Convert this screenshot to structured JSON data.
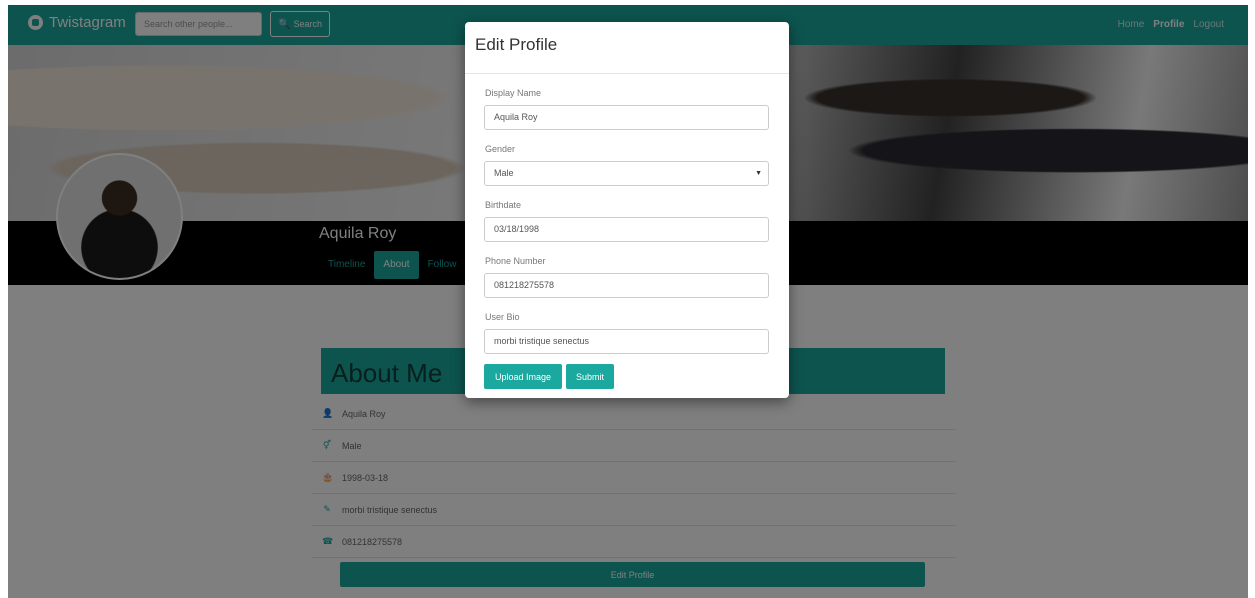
{
  "navbar": {
    "brand": "Twistagram",
    "search_placeholder": "Search other people...",
    "search_button": "Search",
    "links": [
      {
        "label": "Home",
        "active": false
      },
      {
        "label": "Profile",
        "active": true
      },
      {
        "label": "Logout",
        "active": false
      }
    ]
  },
  "profile": {
    "name": "Aquila Roy",
    "tabs": [
      {
        "label": "Timeline",
        "active": false
      },
      {
        "label": "About",
        "active": true
      },
      {
        "label": "Follow",
        "active": false
      }
    ]
  },
  "about": {
    "title": "About Me",
    "rows": [
      {
        "icon": "user-icon",
        "value": "Aquila Roy"
      },
      {
        "icon": "gender-icon",
        "value": "Male"
      },
      {
        "icon": "birthday-cake-icon",
        "value": "1998-03-18"
      },
      {
        "icon": "pencil-icon",
        "value": "morbi tristique senectus"
      },
      {
        "icon": "phone-icon",
        "value": "081218275578"
      }
    ],
    "edit_button": "Edit Profile"
  },
  "modal": {
    "title": "Edit Profile",
    "display_name_label": "Display Name",
    "display_name_value": "Aquila Roy",
    "gender_label": "Gender",
    "gender_value": "Male",
    "birthdate_label": "Birthdate",
    "birthdate_value": "03/18/1998",
    "phone_label": "Phone Number",
    "phone_value": "081218275578",
    "bio_label": "User Bio",
    "bio_value": "morbi tristique senectus",
    "upload_button": "Upload Image",
    "submit_button": "Submit"
  },
  "colors": {
    "accent": "#1ba89f",
    "profile_bar": "#000000",
    "overlay": "rgba(0,0,0,0.5)"
  }
}
